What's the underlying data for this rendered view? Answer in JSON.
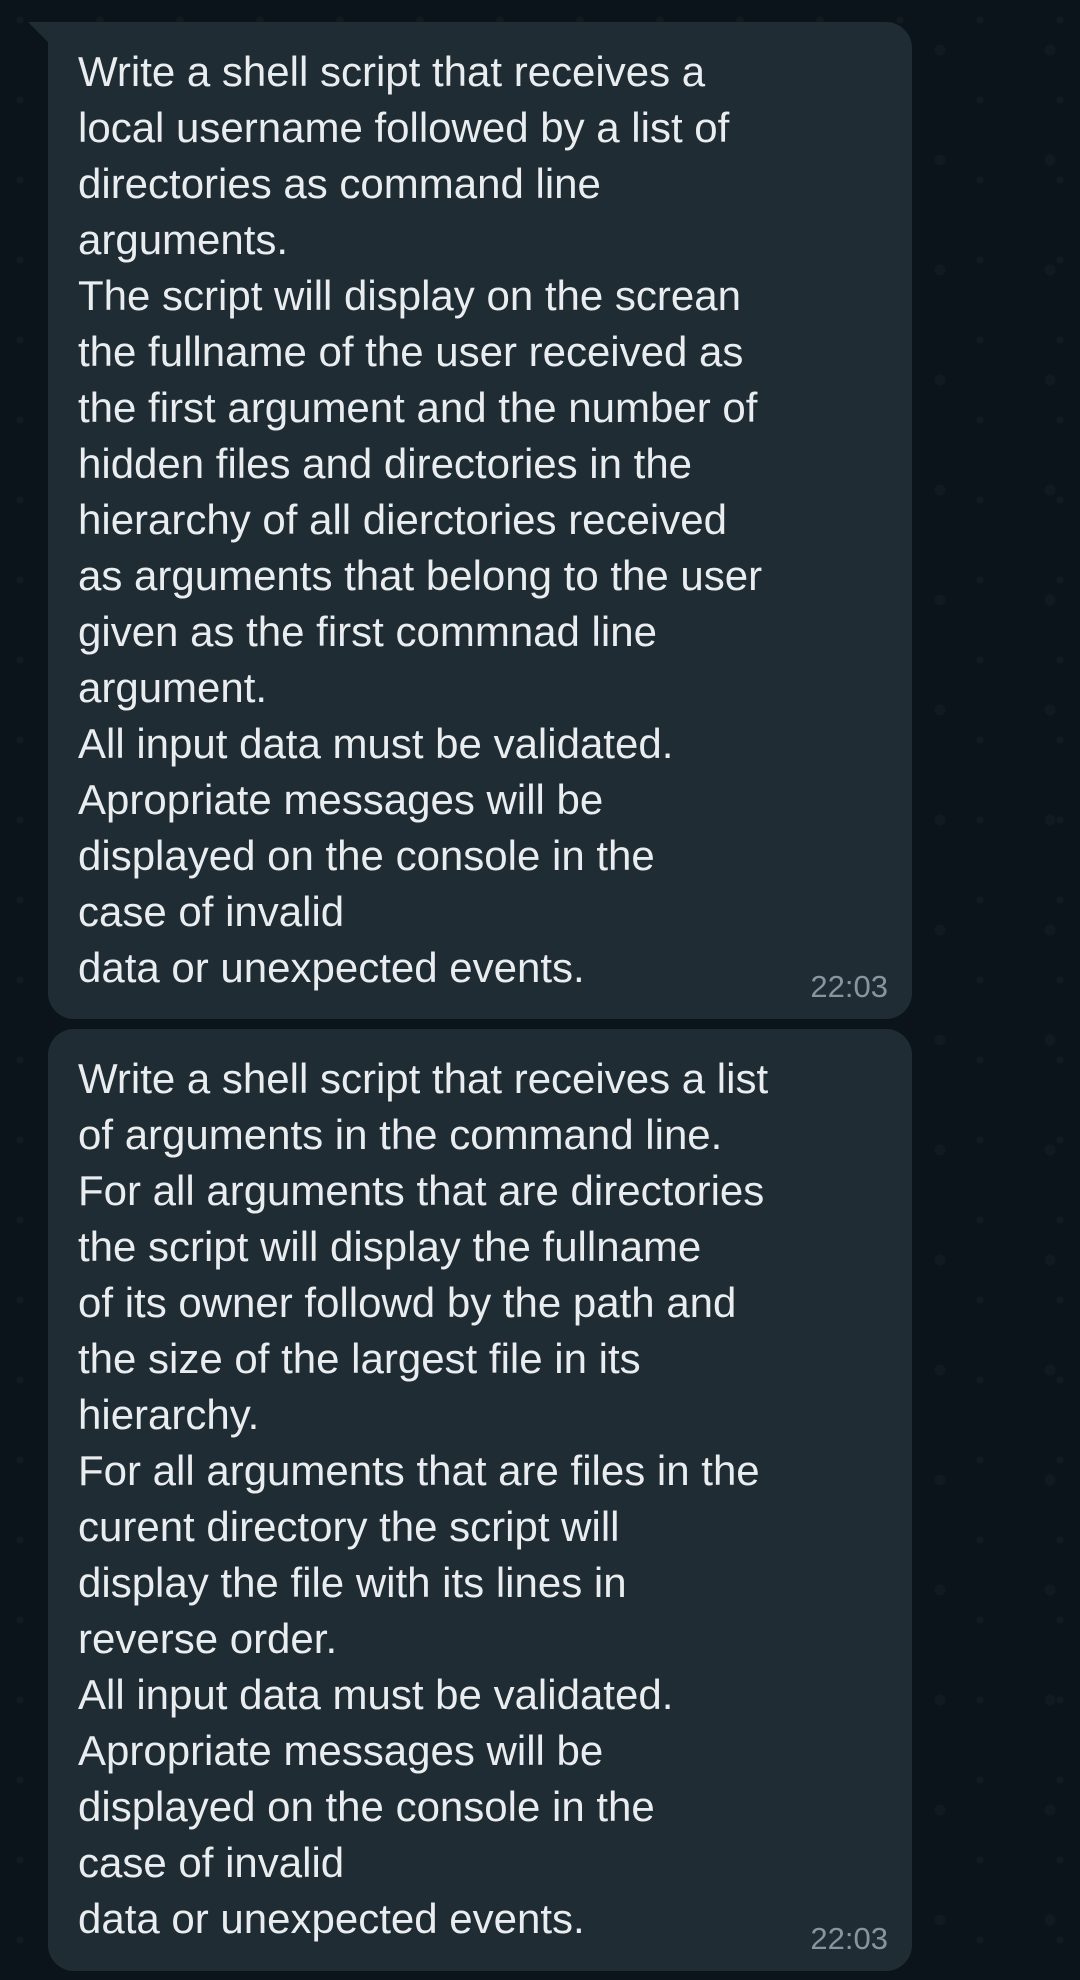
{
  "messages": [
    {
      "text": "Write a shell script that receives a\nlocal username followed by a list of\ndirectories as command line\narguments.\nThe script will display on the screan\nthe fullname of the user received as\nthe first argument and the number of\nhidden files and directories in the\nhierarchy of all dierctories received\nas arguments that belong to the user\ngiven as the first commnad line\nargument.\nAll input data must be validated.\nApropriate messages will be\ndisplayed on the console in the\ncase of invalid\ndata or unexpected events.",
      "time": "22:03"
    },
    {
      "text": "Write a shell script that receives a list\nof arguments in the command line.\nFor all arguments that are directories\nthe script will display the fullname\nof its owner followd by the path and\nthe size of the largest file in its\nhierarchy.\nFor all arguments that are files in the\ncurent directory the script will\ndisplay the file with its lines in\nreverse order.\nAll input data must be validated.\nApropriate messages will be\ndisplayed on the console in the\ncase of invalid\ndata or unexpected events.",
      "time": "22:03"
    }
  ],
  "colors": {
    "background": "#0b141a",
    "bubble": "#202c33",
    "text": "#e9edef",
    "time": "#8696a0"
  }
}
